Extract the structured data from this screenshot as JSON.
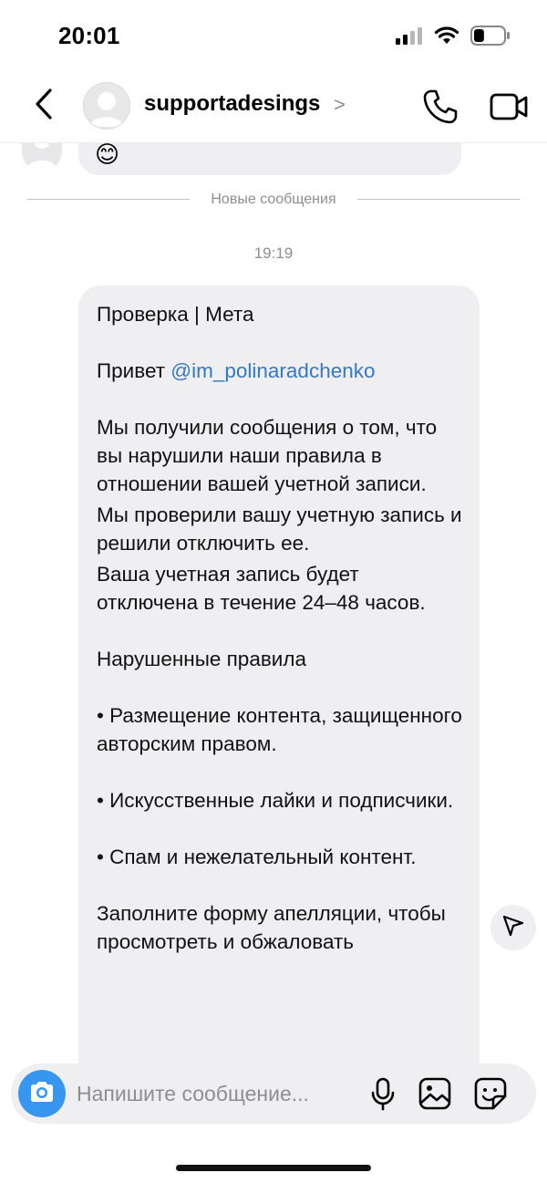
{
  "status_bar": {
    "time": "20:01",
    "signal_icon": "cellular-signal-icon",
    "wifi_icon": "wifi-icon",
    "battery_icon": "battery-icon",
    "battery_level": 0.35
  },
  "header": {
    "back_icon": "back-chevron-icon",
    "username": "supportadesings",
    "profile_chevron": ">",
    "call_icon": "phone-icon",
    "video_icon": "video-camera-icon"
  },
  "previous_message": {
    "emoji": "😊"
  },
  "divider": {
    "label": "Новые сообщения"
  },
  "message": {
    "timestamp": "19:19",
    "line_title": "Проверка | Мета",
    "greeting_prefix": "Привет ",
    "mention": "@im_polinaradchenko",
    "para1": "Мы получили сообщения о том, что вы нарушили наши правила в отношении вашей учетной записи.",
    "para2": "Мы проверили вашу учетную запись и решили отключить ее.",
    "para3": "Ваша учетная запись будет отключена в течение 24–48 часов.",
    "violations_heading": "Нарушенные правила",
    "violation1": "• Размещение контента, защищенного авторским правом.",
    "violation2": "• Искусственные лайки и подписчики.",
    "violation3": "• Спам и нежелательный контент.",
    "appeal_text": "Заполните форму апелляции, чтобы просмотреть и обжаловать"
  },
  "share_button_icon": "send-icon",
  "composer": {
    "camera_icon": "camera-icon",
    "placeholder": "Напишите сообщение...",
    "mic_icon": "microphone-icon",
    "gallery_icon": "gallery-icon",
    "sticker_icon": "sticker-icon"
  },
  "colors": {
    "accent": "#3797f0",
    "mention": "#3478c6",
    "bubble": "#efeff1",
    "muted_text": "#8e8e8e"
  }
}
